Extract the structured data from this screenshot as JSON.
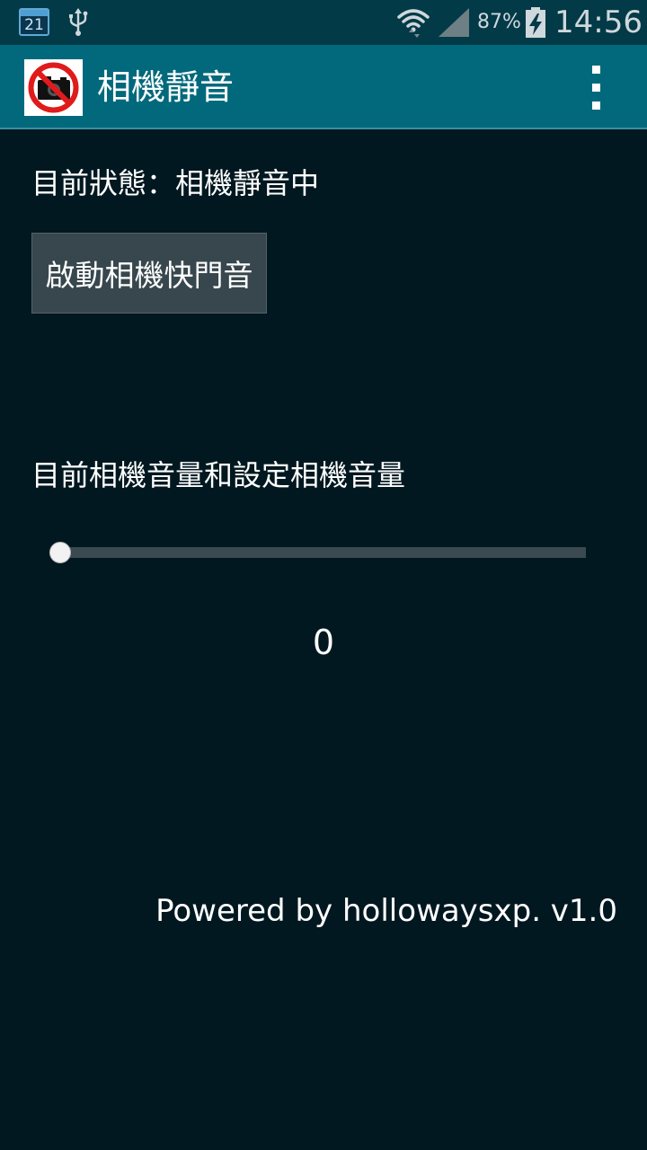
{
  "status_bar": {
    "calendar_day": "21",
    "battery_percent": "87%",
    "time": "14:56",
    "icons": [
      "calendar-icon",
      "usb-icon",
      "wifi-icon",
      "signal-icon",
      "battery-charging-icon"
    ]
  },
  "action_bar": {
    "title": "相機靜音",
    "logo_icon": "camera-muted-icon",
    "menu_icon": "overflow-menu-icon"
  },
  "main": {
    "status_text": "目前狀態：相機靜音中",
    "enable_button_label": "啟動相機快門音",
    "volume_label": "目前相機音量和設定相機音量",
    "volume_value": "0",
    "volume_level": 0,
    "volume_max": 1
  },
  "footer": {
    "powered_by": "Powered by hollowaysxp. v1.0"
  },
  "colors": {
    "status_bar_bg": "#033a47",
    "action_bar_bg": "#02697c",
    "background": "#021820",
    "button_bg": "#37474d",
    "slider_track": "#3a4a50"
  }
}
